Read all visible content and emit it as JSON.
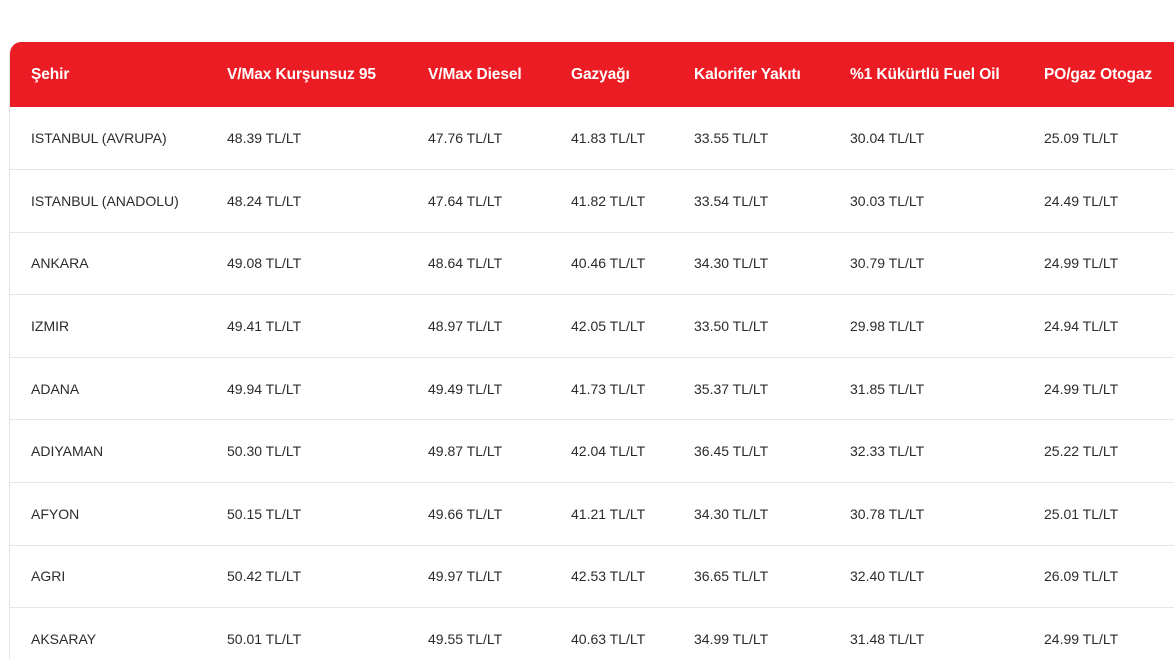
{
  "colors": {
    "header_bg": "#ec1c24",
    "header_text": "#ffffff",
    "row_text": "#2b2b2b",
    "row_divider": "#e6e6e6"
  },
  "table": {
    "headers": [
      "Şehir",
      "V/Max Kurşunsuz 95",
      "V/Max Diesel",
      "Gazyağı",
      "Kalorifer Yakıtı",
      "%1 Kükürtlü Fuel Oil",
      "PO/gaz Otogaz"
    ],
    "rows": [
      [
        "ISTANBUL (AVRUPA)",
        "48.39 TL/LT",
        "47.76 TL/LT",
        "41.83 TL/LT",
        "33.55 TL/LT",
        "30.04 TL/LT",
        "25.09 TL/LT"
      ],
      [
        "ISTANBUL (ANADOLU)",
        "48.24 TL/LT",
        "47.64 TL/LT",
        "41.82 TL/LT",
        "33.54 TL/LT",
        "30.03 TL/LT",
        "24.49 TL/LT"
      ],
      [
        "ANKARA",
        "49.08 TL/LT",
        "48.64 TL/LT",
        "40.46 TL/LT",
        "34.30 TL/LT",
        "30.79 TL/LT",
        "24.99 TL/LT"
      ],
      [
        "IZMIR",
        "49.41 TL/LT",
        "48.97 TL/LT",
        "42.05 TL/LT",
        "33.50 TL/LT",
        "29.98 TL/LT",
        "24.94 TL/LT"
      ],
      [
        "ADANA",
        "49.94 TL/LT",
        "49.49 TL/LT",
        "41.73 TL/LT",
        "35.37 TL/LT",
        "31.85 TL/LT",
        "24.99 TL/LT"
      ],
      [
        "ADIYAMAN",
        "50.30 TL/LT",
        "49.87 TL/LT",
        "42.04 TL/LT",
        "36.45 TL/LT",
        "32.33 TL/LT",
        "25.22 TL/LT"
      ],
      [
        "AFYON",
        "50.15 TL/LT",
        "49.66 TL/LT",
        "41.21 TL/LT",
        "34.30 TL/LT",
        "30.78 TL/LT",
        "25.01 TL/LT"
      ],
      [
        "AGRI",
        "50.42 TL/LT",
        "49.97 TL/LT",
        "42.53 TL/LT",
        "36.65 TL/LT",
        "32.40 TL/LT",
        "26.09 TL/LT"
      ],
      [
        "AKSARAY",
        "50.01 TL/LT",
        "49.55 TL/LT",
        "40.63 TL/LT",
        "34.99 TL/LT",
        "31.48 TL/LT",
        "24.99 TL/LT"
      ]
    ]
  }
}
